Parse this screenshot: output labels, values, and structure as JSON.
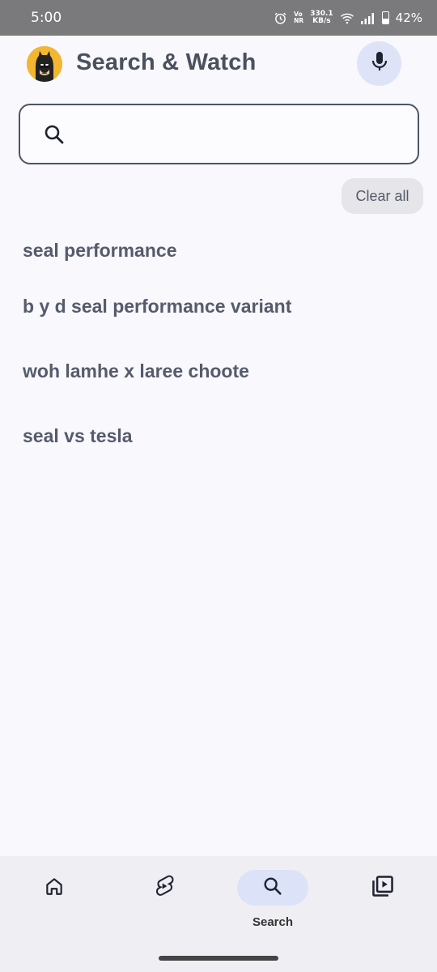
{
  "status_bar": {
    "time": "5:00",
    "volte_top": "Vo",
    "volte_bottom": "NR",
    "speed_value": "330.1",
    "speed_unit": "KB/s",
    "battery": "42%",
    "icons": [
      "alarm-icon",
      "wifi-icon",
      "signal-icon",
      "battery-icon"
    ]
  },
  "header": {
    "title": "Search & Watch",
    "avatar": "batman-avatar",
    "mic_icon": "microphone-icon"
  },
  "search": {
    "placeholder": "",
    "value": "",
    "icon": "search-icon"
  },
  "clear_all_label": "Clear all",
  "history": [
    "seal performance",
    "b y d seal performance variant",
    "woh lamhe x laree choote",
    "seal vs tesla"
  ],
  "bottom_nav": {
    "items": [
      {
        "icon": "home-icon",
        "label": ""
      },
      {
        "icon": "shorts-icon",
        "label": ""
      },
      {
        "icon": "search-icon",
        "label": "Search",
        "active": true
      },
      {
        "icon": "library-icon",
        "label": ""
      }
    ]
  },
  "colors": {
    "background": "#f8f8fd",
    "active_pill": "#dce2f8",
    "mic_bg": "#dfe3f7",
    "avatar_bg": "#f2b632",
    "text": "#555b6b"
  }
}
